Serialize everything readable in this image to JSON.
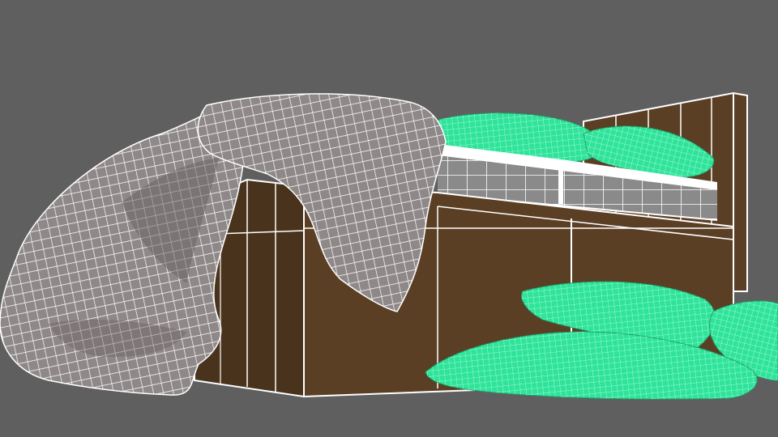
{
  "viewport": {
    "background": "#5f5f5f"
  },
  "colors": {
    "bed_wood": "#5b3f25",
    "bed_wood_dark": "#4a331d",
    "wire_white": "#ffffff",
    "mattress_gray": "#8a8a8a",
    "cloth_gray": "#8f8888",
    "cloth_shadow": "#6c6464",
    "pillow_green": "#2fe39a",
    "pillow_green_dark": "#1aa56a"
  },
  "scene_objects": [
    {
      "name": "bed-frame",
      "type": "wireframe-mesh",
      "color_key": "bed_wood"
    },
    {
      "name": "mattress",
      "type": "wireframe-mesh",
      "color_key": "mattress_gray"
    },
    {
      "name": "blanket-cloth",
      "type": "wireframe-mesh",
      "color_key": "cloth_gray"
    },
    {
      "name": "pillow",
      "type": "wireframe-mesh",
      "color_key": "pillow_green"
    }
  ]
}
